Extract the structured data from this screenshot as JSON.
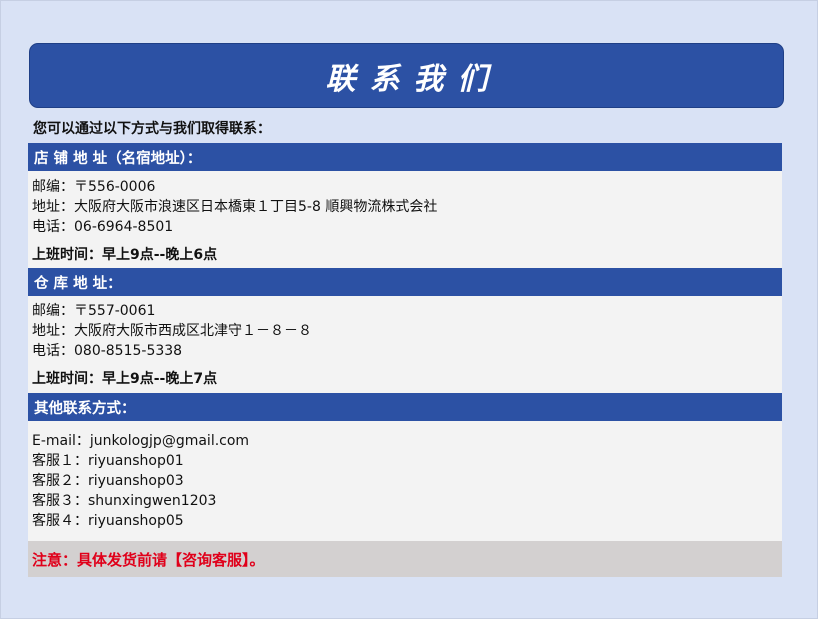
{
  "banner": {
    "title": "联系我们"
  },
  "intro": "您可以通过以下方式与我们取得联系：",
  "store": {
    "header": "店 铺 地 址（名宿地址）：",
    "postal": "邮编：〒556-0006",
    "address": "地址：大阪府大阪市浪速区日本橋東１丁目5-8 順興物流株式会社",
    "phone": "电话：06-6964-8501",
    "hours": "上班时间：早上9点--晚上6点"
  },
  "warehouse": {
    "header": "仓 库 地 址：",
    "postal": "邮编：〒557-0061",
    "address": "地址：大阪府大阪市西成区北津守１－８－８",
    "phone": "电话：080-8515-5338",
    "hours": "上班时间：早上9点--晚上7点"
  },
  "other": {
    "header": "其他联系方式：",
    "email": "E-mail：junkologjp@gmail.com",
    "service1": "客服１：riyuanshop01",
    "service2": "客服２：riyuanshop03",
    "service3": "客服３：shunxingwen1203",
    "service4": "客服４：riyuanshop05"
  },
  "notice": "注意：具体发货前请【咨询客服】。",
  "colors": {
    "accent": "#2c51a4",
    "background": "#d9e2f5",
    "notice": "#e0001a"
  }
}
